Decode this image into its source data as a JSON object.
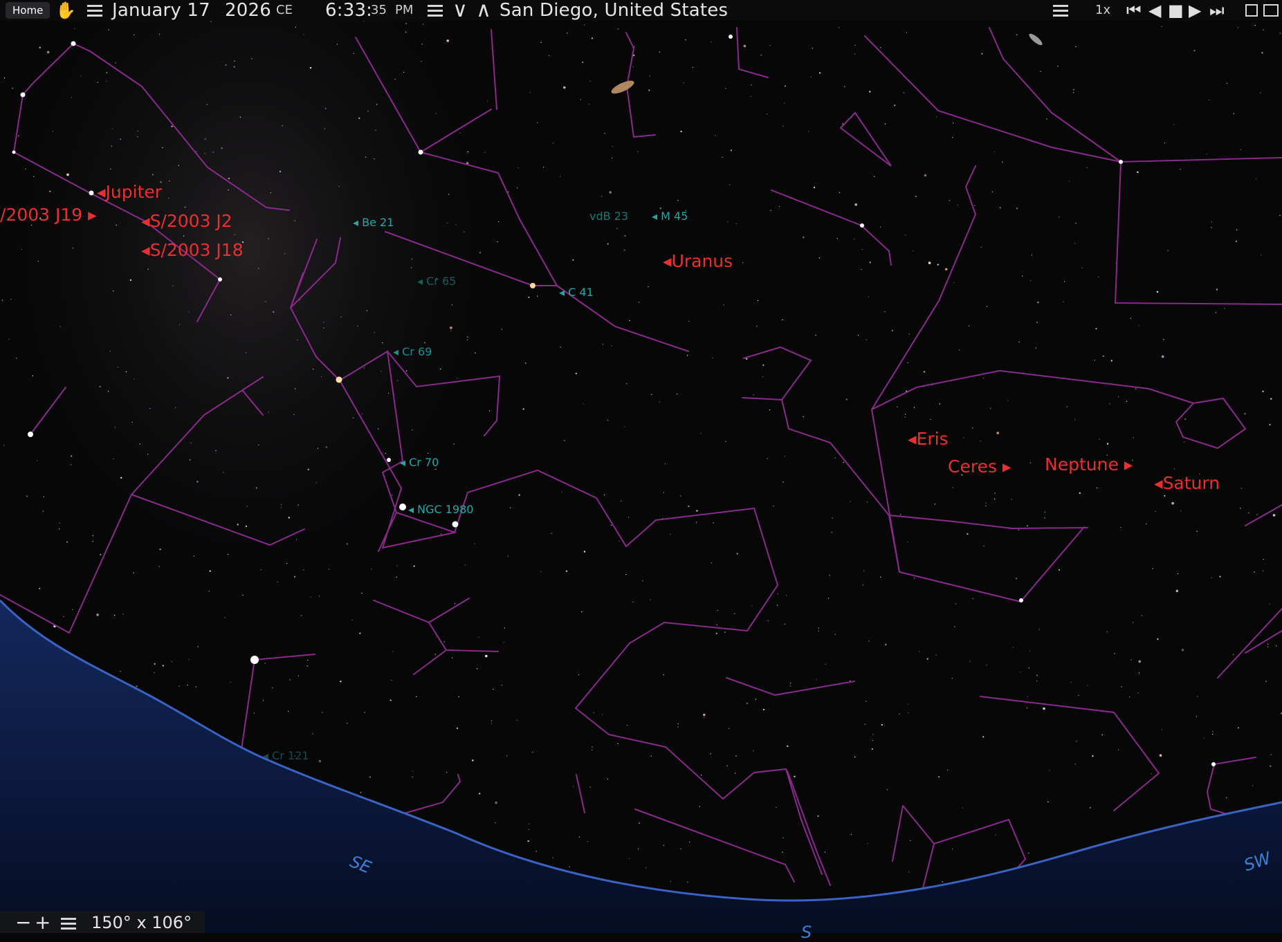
{
  "toolbar": {
    "home": "Home",
    "month_day": "January 17",
    "year": "2026",
    "era": "CE",
    "time_hm": "6:33:",
    "time_s": "35",
    "ampm": "PM",
    "location": "San Diego, United States",
    "rate": "1x"
  },
  "footer": {
    "fov": "150° x 106°"
  },
  "planet_labels": [
    {
      "text": "Jupiter"
    },
    {
      "text": "/2003 J19"
    },
    {
      "text": "S/2003 J2"
    },
    {
      "text": "S/2003 J18"
    },
    {
      "text": "Uranus"
    },
    {
      "text": "Eris"
    },
    {
      "text": "Ceres"
    },
    {
      "text": "Neptune"
    },
    {
      "text": "Saturn"
    }
  ],
  "dso_labels": [
    {
      "text": "Be 21"
    },
    {
      "text": "vdB 23"
    },
    {
      "text": "M 45"
    },
    {
      "text": "Cr 65"
    },
    {
      "text": "C 41"
    },
    {
      "text": "Cr 69"
    },
    {
      "text": "Cr 70"
    },
    {
      "text": "NGC 1980"
    },
    {
      "text": "Cr 121"
    }
  ],
  "compass": {
    "se": "SE",
    "sw": "SW",
    "s": "S"
  },
  "colors": {
    "constellation_lines": "#8a2a8c",
    "planet_label": "#e83030",
    "dso_label": "#1e9e9e",
    "ground": "#0c1a3f",
    "horizon": "#2b4ea6",
    "compass": "#3c7fd6"
  }
}
